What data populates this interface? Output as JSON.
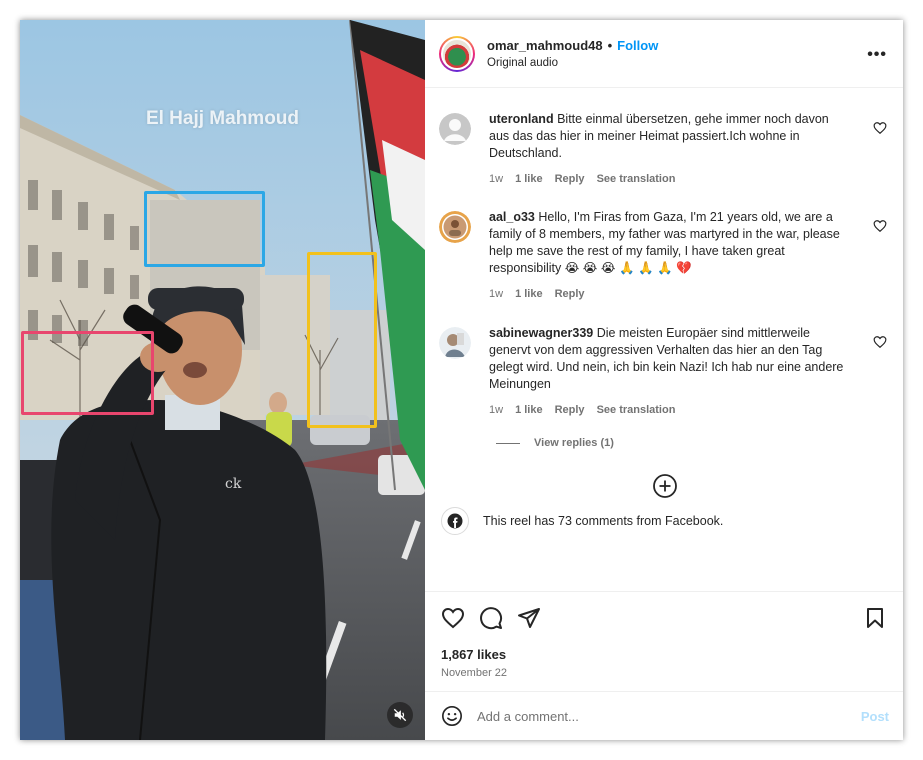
{
  "media": {
    "overlay_caption": "El Hajj Mahmoud",
    "highlight_colors": {
      "blue": "#2ba7e6",
      "yellow": "#f2c11c",
      "pink": "#e8466e"
    },
    "mute_icon": "speaker-muted-icon"
  },
  "post": {
    "owner_username": "omar_mahmoud48",
    "separator": "•",
    "follow_label": "Follow",
    "audio_label": "Original audio",
    "more_icon": "more-options-icon",
    "more_label": "•••"
  },
  "comments": [
    {
      "username": "uteronland",
      "text": "Bitte einmal übersetzen, gehe immer noch davon aus das das hier in meiner Heimat passiert.Ich wohne in Deutschland.",
      "age": "1w",
      "likes": "1 like",
      "reply_label": "Reply",
      "translation_label": "See translation"
    },
    {
      "username": "aal_o33",
      "text": "Hello, I'm Firas from Gaza, I'm 21 years old, we are a family of 8 members, my father was martyred in the war, please help me save the rest of my family, I have taken great responsibility 😭 😭 😭 🙏 🙏 🙏 💔",
      "age": "1w",
      "likes": "1 like",
      "reply_label": "Reply"
    },
    {
      "username": "sabinewagner339",
      "text": "Die meisten Europäer sind mittlerweile genervt von dem aggressiven Verhalten das hier an den Tag gelegt wird. Und nein, ich bin kein Nazi! Ich hab nur eine andere Meinungen",
      "age": "1w",
      "likes": "1 like",
      "reply_label": "Reply",
      "translation_label": "See translation"
    }
  ],
  "view_replies_label": "View replies (1)",
  "facebook_note": "This reel has 73 comments from Facebook.",
  "likes_count": "1,867 likes",
  "post_date": "November 22",
  "comment_box": {
    "placeholder": "Add a comment...",
    "post_label": "Post"
  },
  "colors": {
    "link_blue": "#0095f6",
    "post_disabled": "#b2dffc",
    "secondary_text": "#737373"
  }
}
